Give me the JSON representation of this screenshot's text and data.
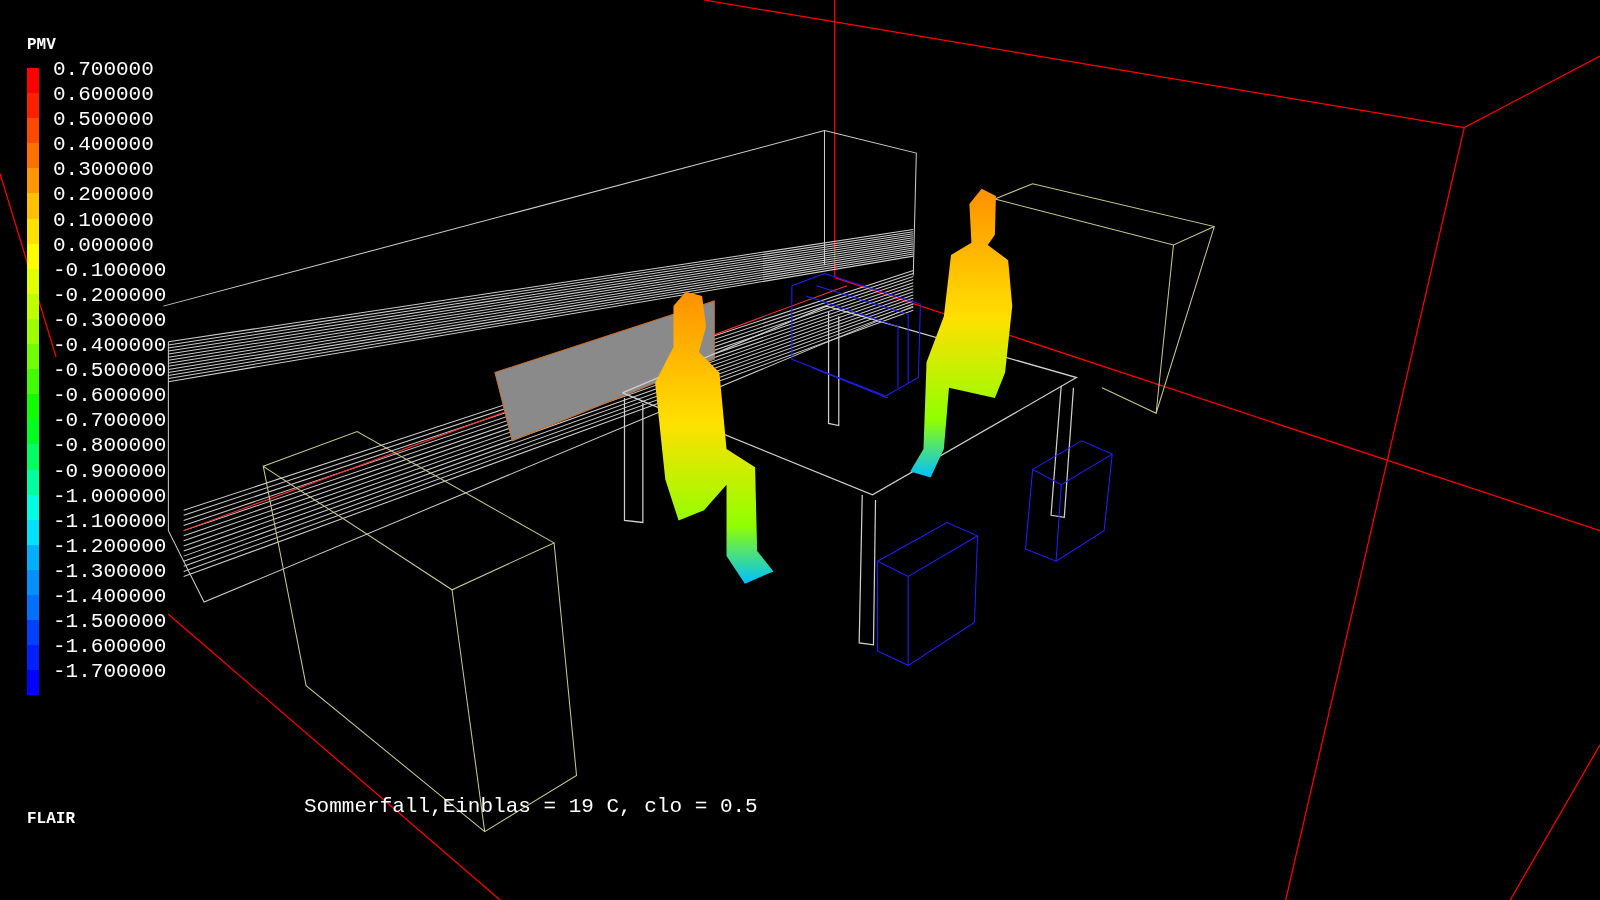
{
  "legend": {
    "title": "PMV",
    "entries": [
      {
        "label": "0.700000",
        "color": "#ff0000"
      },
      {
        "label": "0.600000",
        "color": "#ff2000"
      },
      {
        "label": "0.500000",
        "color": "#ff4800"
      },
      {
        "label": "0.400000",
        "color": "#ff7000"
      },
      {
        "label": "0.300000",
        "color": "#ff9800"
      },
      {
        "label": "0.200000",
        "color": "#ffc000"
      },
      {
        "label": "0.100000",
        "color": "#ffe000"
      },
      {
        "label": "0.000000",
        "color": "#ffff00"
      },
      {
        "label": "-0.100000",
        "color": "#e0ff00"
      },
      {
        "label": "-0.200000",
        "color": "#c0ff00"
      },
      {
        "label": "-0.300000",
        "color": "#a0ff00"
      },
      {
        "label": "-0.400000",
        "color": "#70ff00"
      },
      {
        "label": "-0.500000",
        "color": "#40ff00"
      },
      {
        "label": "-0.600000",
        "color": "#10ff00"
      },
      {
        "label": "-0.700000",
        "color": "#00ff20"
      },
      {
        "label": "-0.800000",
        "color": "#00ff60"
      },
      {
        "label": "-0.900000",
        "color": "#00ffa0"
      },
      {
        "label": "-1.000000",
        "color": "#00ffe0"
      },
      {
        "label": "-1.100000",
        "color": "#00e0ff"
      },
      {
        "label": "-1.200000",
        "color": "#00b0ff"
      },
      {
        "label": "-1.300000",
        "color": "#0090ff"
      },
      {
        "label": "-1.400000",
        "color": "#0070ff"
      },
      {
        "label": "-1.500000",
        "color": "#0040ff"
      },
      {
        "label": "-1.600000",
        "color": "#0020ff"
      },
      {
        "label": "-1.700000",
        "color": "#0000ff"
      }
    ]
  },
  "program_label": "FLAIR",
  "caption": "Sommerfall,Einblas = 19 C, clo = 0.5"
}
